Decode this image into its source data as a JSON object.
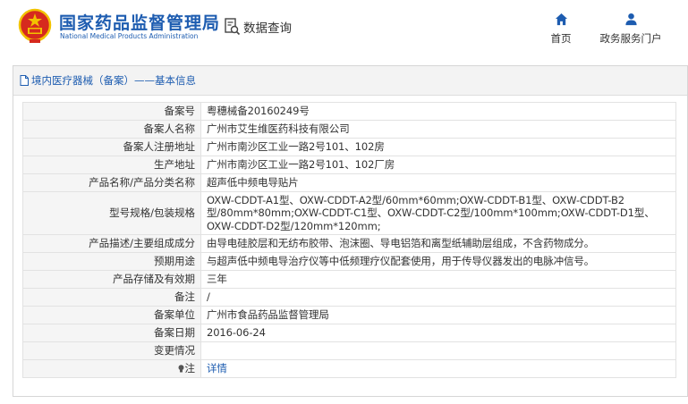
{
  "header": {
    "org_name_cn": "国家药品监督管理局",
    "org_name_en": "National Medical Products Administration",
    "query_label": "数据查询",
    "nav": [
      {
        "icon": "home-icon",
        "label": "首页"
      },
      {
        "icon": "user-icon",
        "label": "政务服务门户"
      }
    ]
  },
  "panel": {
    "title": "境内医疗器械（备案）——基本信息"
  },
  "rows": [
    {
      "label": "备案号",
      "value": "粤穗械备20160249号"
    },
    {
      "label": "备案人名称",
      "value": "广州市艾生维医药科技有限公司"
    },
    {
      "label": "备案人注册地址",
      "value": "广州市南沙区工业一路2号101、102房"
    },
    {
      "label": "生产地址",
      "value": "广州市南沙区工业一路2号101、102厂房"
    },
    {
      "label": "产品名称/产品分类名称",
      "value": "超声低中频电导贴片"
    },
    {
      "label": "型号规格/包装规格",
      "value": "OXW-CDDT-A1型、OXW-CDDT-A2型/60mm*60mm;OXW-CDDT-B1型、OXW-CDDT-B2型/80mm*80mm;OXW-CDDT-C1型、OXW-CDDT-C2型/100mm*100mm;OXW-CDDT-D1型、OXW-CDDT-D2型/120mm*120mm;"
    },
    {
      "label": "产品描述/主要组成成分",
      "value": "由导电硅胶层和无纺布胶带、泡沫圈、导电铝箔和离型纸辅助层组成，不含药物成分。"
    },
    {
      "label": "预期用途",
      "value": "与超声低中频电导治疗仪等中低频理疗仪配套使用，用于传导仪器发出的电脉冲信号。"
    },
    {
      "label": "产品存储及有效期",
      "value": "三年"
    },
    {
      "label": "备注",
      "value": "/"
    },
    {
      "label": "备案单位",
      "value": "广州市食品药品监督管理局"
    },
    {
      "label": "备案日期",
      "value": "2016-06-24"
    },
    {
      "label": "变更情况",
      "value": ""
    },
    {
      "label": "注",
      "value": "详情"
    }
  ],
  "colors": {
    "brand_blue": "#1d5cb0",
    "emblem_red": "#d62a1e",
    "emblem_gold": "#f2c200",
    "label_bg": "#f5f5f5"
  }
}
